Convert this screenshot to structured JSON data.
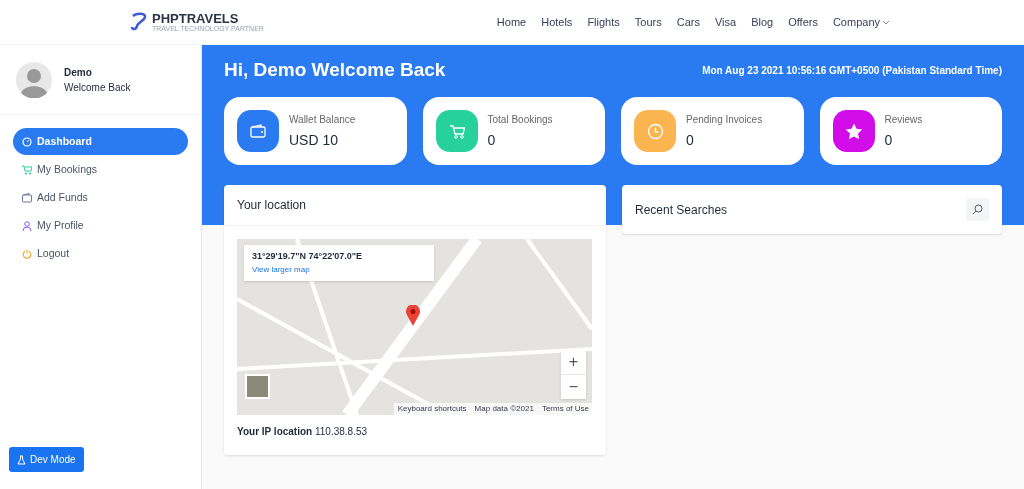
{
  "header": {
    "logo": {
      "name": "PHPTRAVELS",
      "tagline": "TRAVEL TECHNOLOGY PARTNER"
    },
    "nav": [
      {
        "label": "Home",
        "kind": "link"
      },
      {
        "label": "Hotels",
        "kind": "link"
      },
      {
        "label": "Flights",
        "kind": "link"
      },
      {
        "label": "Tours",
        "kind": "link"
      },
      {
        "label": "Cars",
        "kind": "link"
      },
      {
        "label": "Visa",
        "kind": "link"
      },
      {
        "label": "Blog",
        "kind": "link"
      },
      {
        "label": "Offers",
        "kind": "link"
      },
      {
        "label": "Company",
        "kind": "dropdown"
      }
    ]
  },
  "sidebar": {
    "user": {
      "name": "Demo",
      "subtitle": "Welcome Back"
    },
    "items": [
      {
        "label": "Dashboard",
        "kind": "dashboard",
        "selected": true
      },
      {
        "label": "My Bookings",
        "kind": "bookings",
        "selected": false
      },
      {
        "label": "Add Funds",
        "kind": "funds",
        "selected": false
      },
      {
        "label": "My Profile",
        "kind": "profile",
        "selected": false
      },
      {
        "label": "Logout",
        "kind": "logout",
        "selected": false
      }
    ],
    "dev_button": "Dev Mode"
  },
  "banner": {
    "greeting": "Hi, Demo Welcome Back",
    "datetime": "Mon Aug 23 2021 10:56:16 GMT+0500 (Pakistan Standard Time)"
  },
  "stats": [
    {
      "label": "Wallet Balance",
      "value": "USD 10",
      "kind": "wallet",
      "color": "#2a7bf2"
    },
    {
      "label": "Total Bookings",
      "value": "0",
      "kind": "bookings",
      "color": "#27d19c"
    },
    {
      "label": "Pending Invoices",
      "value": "0",
      "kind": "invoices",
      "color": "#fbb550"
    },
    {
      "label": "Reviews",
      "value": "0",
      "kind": "reviews",
      "color": "#d10ce8"
    }
  ],
  "location": {
    "title": "Your location",
    "map": {
      "coords": "31°29'19.7\"N 74°22'07.0\"E",
      "larger_link": "View larger map",
      "zoom_in": "+",
      "zoom_out": "−",
      "attribution": [
        "Keyboard shortcuts",
        "Map data ©2021",
        "Terms of Use"
      ]
    },
    "ip_label": "Your IP location",
    "ip": "110.38.8.53"
  },
  "recent": {
    "title": "Recent Searches"
  }
}
